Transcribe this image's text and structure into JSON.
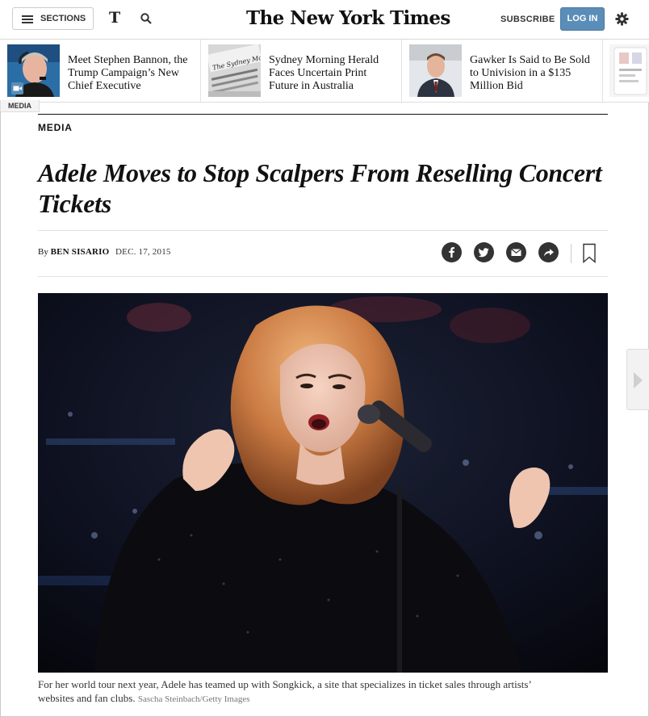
{
  "header": {
    "sections_label": "SECTIONS",
    "t_logo": "T",
    "masthead": "The New York Times",
    "subscribe_label": "SUBSCRIBE",
    "login_label": "LOG IN"
  },
  "related": {
    "tag": "MEDIA",
    "items": [
      {
        "title": "Meet Stephen Bannon, the Trump Campaign’s New Chief Executive",
        "thumb": "bannon-photo"
      },
      {
        "title": "Sydney Morning Herald Faces Uncertain Print Future in Australia",
        "thumb": "sydney-morning-herald-masthead",
        "thumb_text": "The Sydney Morning Herald"
      },
      {
        "title": "Gawker Is Said to Be Sold to Univision in a $135 Million Bid",
        "thumb": "gawker-executive-photo"
      }
    ]
  },
  "article": {
    "kicker": "MEDIA",
    "headline": "Adele Moves to Stop Scalpers From Reselling Concert Tickets",
    "byline_prefix": "By",
    "author": "BEN SISARIO",
    "date": "DEC. 17, 2015",
    "share_icons": [
      "facebook-icon",
      "twitter-icon",
      "email-icon",
      "share-icon"
    ],
    "photo": "adele-singing-on-stage",
    "caption": "For her world tour next year, Adele has teamed up with Songkick, a site that specializes in ticket sales through artists’ websites and fan clubs.",
    "credit": "Sascha Steinbach/Getty Images"
  },
  "colors": {
    "accent": "#5a8db7",
    "text": "#111111"
  }
}
